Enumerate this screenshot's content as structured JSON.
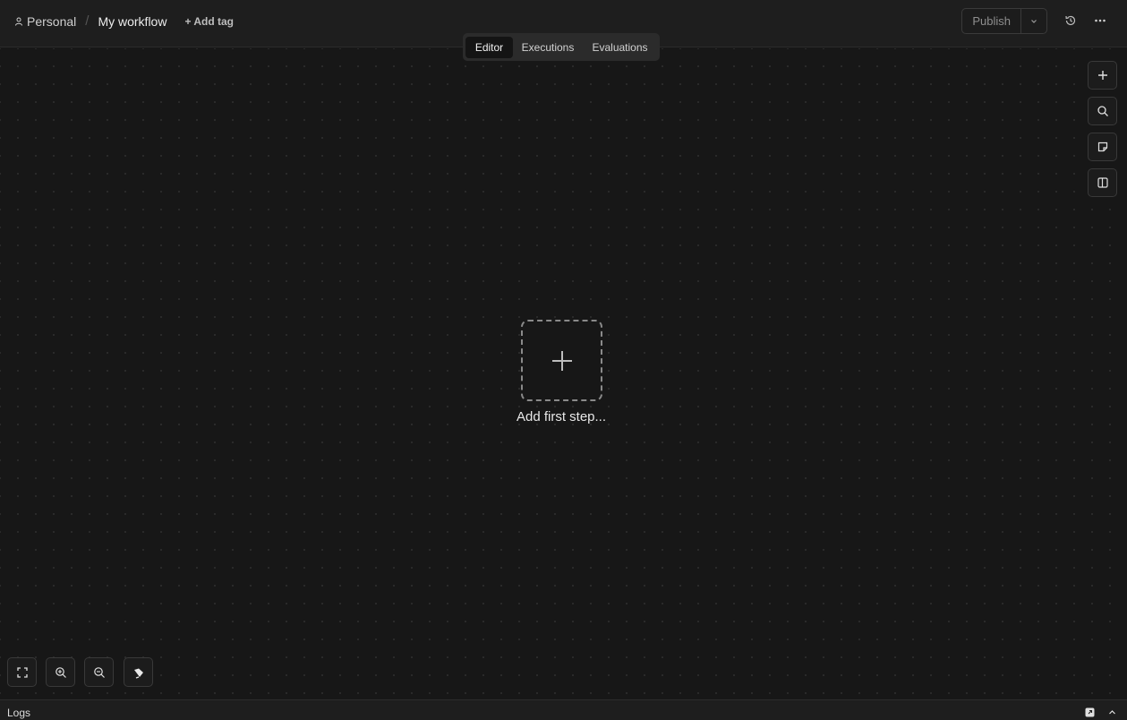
{
  "header": {
    "project": "Personal",
    "separator": "/",
    "workflow_title": "My workflow",
    "add_tag": "+ Add tag",
    "publish": "Publish"
  },
  "tabs": [
    {
      "label": "Editor",
      "active": true
    },
    {
      "label": "Executions",
      "active": false
    },
    {
      "label": "Evaluations",
      "active": false
    }
  ],
  "canvas": {
    "add_first_step": "Add first step..."
  },
  "logs": {
    "label": "Logs"
  },
  "icons": {
    "project": "user-icon",
    "publish_dropdown": "chevron-down-icon",
    "history": "history-icon",
    "more": "more-horizontal-icon",
    "side": [
      "plus-icon",
      "search-icon",
      "sticky-note-icon",
      "panel-right-icon"
    ],
    "zoom": [
      "fit-view-icon",
      "zoom-in-icon",
      "zoom-out-icon",
      "tidy-up-icon"
    ],
    "logs": [
      "popout-icon",
      "chevron-up-icon"
    ]
  },
  "colors": {
    "background": "#171717",
    "header": "#1e1e1e",
    "border": "#393939",
    "text": "#e5e5e5"
  }
}
